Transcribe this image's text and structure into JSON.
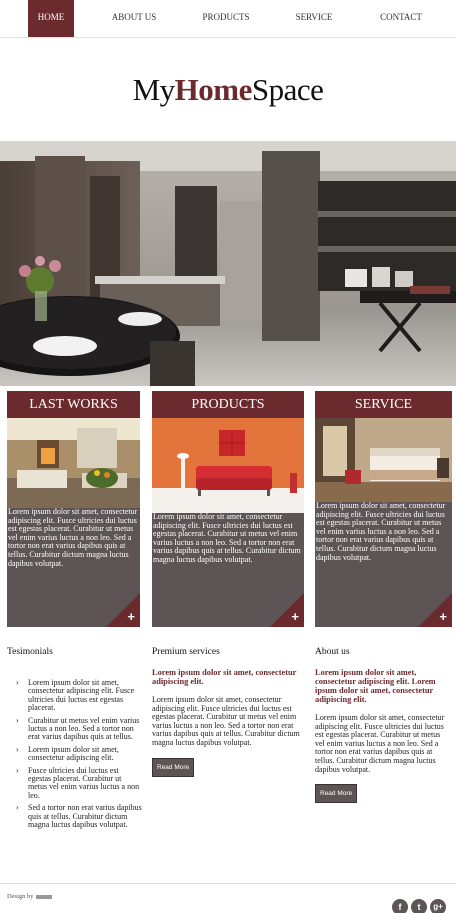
{
  "nav": {
    "items": [
      {
        "label": "HOME",
        "active": true
      },
      {
        "label": "ABOUT US",
        "active": false
      },
      {
        "label": "PRODUCTS",
        "active": false
      },
      {
        "label": "SERVICE",
        "active": false
      },
      {
        "label": "CONTACT",
        "active": false
      }
    ]
  },
  "logo": {
    "left": "My",
    "mid": "Home",
    "right": "Space"
  },
  "cards": [
    {
      "title": "LAST WORKS",
      "text": "Lorem ipsum dolor sit amet, consectetur adipiscing elit. Fusce ultricies dui luctus est egestas placerat. Curabitur ut metus vel enim varius luctus a non leo. Sed a tortor non erat varius dapibus quis at tellus. Curabitur dictum magna luctus dapibus volutpat.",
      "plus": "+"
    },
    {
      "title": "PRODUCTS",
      "text": "Lorem ipsum dolor sit amet, consectetur adipiscing elit. Fusce ultricies dui luctus est egestas placerat. Curabitur ut metus vel enim varius luctus a non leo. Sed a tortor non erat varius dapibus quis at tellus. Curabitur dictum magna luctus dapibus volutpat.",
      "plus": "+"
    },
    {
      "title": "SERVICE",
      "text": "Lorem ipsum dolor sit amet, consectetur adipiscing elit. Fusce ultricies dui luctus est egestas placerat. Curabitur ut metus vel enim varius luctus a non leo. Sed a tortor non erat varius dapibus quis at tellus. Curabitur dictum magna luctus dapibus volutpat.",
      "plus": "+"
    }
  ],
  "testimonials": {
    "title": "Tesimonials",
    "items": [
      "Lorem ipsum dolor sit amet, consectetur adipiscing elit. Fusce ultricies dui luctus est egestas placerat.",
      "Curabitur ut metus vel enim varius luctus a non leo. Sed a tortor non erat varius dapibus quis at tellus.",
      "Lorem ipsum dolor sit amet, consectetur adipiscing elit.",
      "Fusce ultricies dui luctus est egestas placerat. Curabitur ut metus vel enim varius luctus a non leo.",
      "Sed a tortor non erat varius dapibus quis at tellus. Curabitur dictum magna luctus dapibus volutpat."
    ]
  },
  "premium": {
    "title": "Premium services",
    "lead": "Lorem ipsum dolor sit amet, consectetur adipiscing elit.",
    "body": "Lorem ipsum dolor sit amet, consectetur adipiscing elit. Fusce ultricies dui luctus est egestas placerat. Curabitur ut metus vel enim varius luctus a non leo. Sed a tortor non erat varius dapibus quis at tellus. Curabitur dictum magna luctus dapibus volutpat.",
    "button": "Read More"
  },
  "about": {
    "title": "About us",
    "lead": "Lorem ipsum dolor sit amet, consectetur adipiscing elit. Lorem ipsum dolor sit amet, consectetur adipiscing elit.",
    "body": "Lorem ipsum dolor sit amet, consectetur adipiscing elit. Fusce ultricies dui luctus est egestas placerat. Curabitur ut metus vel enim varius luctus a non leo. Sed a tortor non erat varius dapibus quis at tellus. Curabitur dictum magna luctus dapibus volutpat.",
    "button": "Read More"
  },
  "footer": {
    "design_by": "Design by",
    "social": [
      "f",
      "t",
      "g+"
    ]
  },
  "icons": {
    "facebook": "facebook-icon",
    "twitter": "twitter-icon",
    "google_plus": "google-plus-icon",
    "bullet": "chevron-right-icon",
    "plus": "plus-icon"
  },
  "colors": {
    "accent": "#6b2a2e",
    "card_bg": "#5d5555",
    "text": "#222222",
    "background": "#ffffff"
  }
}
